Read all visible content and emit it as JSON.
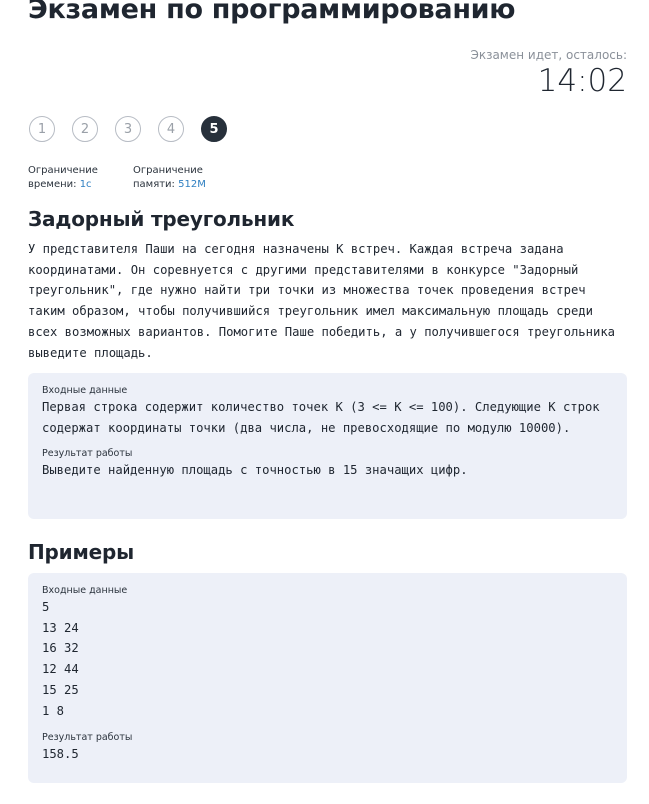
{
  "page": {
    "title": "Экзамен по программированию"
  },
  "timer": {
    "label": "Экзамен идет, осталось:",
    "value": "14:02"
  },
  "steps": [
    {
      "label": "1",
      "active": false
    },
    {
      "label": "2",
      "active": false
    },
    {
      "label": "3",
      "active": false
    },
    {
      "label": "4",
      "active": false
    },
    {
      "label": "5",
      "active": true
    }
  ],
  "limits": {
    "time": {
      "label_line1": "Ограничение",
      "label_line2": "времени:",
      "value": "1c"
    },
    "memory": {
      "label_line1": "Ограничение",
      "label_line2": "памяти:",
      "value": "512M"
    }
  },
  "problem": {
    "title": "Задорный треугольник",
    "statement": "У представителя Паши на сегодня назначены К встреч. Каждая встреча задана координатами. Он соревнуется с другими представителями в конкурсе \"Задорный треугольник\", где нужно найти три точки из множества точек проведения встреч таким образом, чтобы получившийся треугольник имел максимальную площадь среди всех возможных вариантов. Помогите Паше победить, а у получившегося треугольника выведите площадь.",
    "input_label": "Входные данные",
    "input_text": "Первая строка содержит количество точек K (3 <= K <= 100). Следующие K строк содержат координаты точки (два числа, не превосходящие по модулю 10000).",
    "output_label": "Результат работы",
    "output_text": "Выведите найденную площадь с точностью в 15 значащих цифр."
  },
  "examples": {
    "title": "Примеры",
    "input_label": "Входные данные",
    "input_text": "5\n13 24\n16 32\n12 44\n15 25\n1 8",
    "output_label": "Результат работы",
    "output_text": "158.5"
  },
  "colors": {
    "text": "#1f2630",
    "accent_link": "#2f7fc1",
    "box_bg": "#edf0f8",
    "active_step": "#27303b"
  }
}
